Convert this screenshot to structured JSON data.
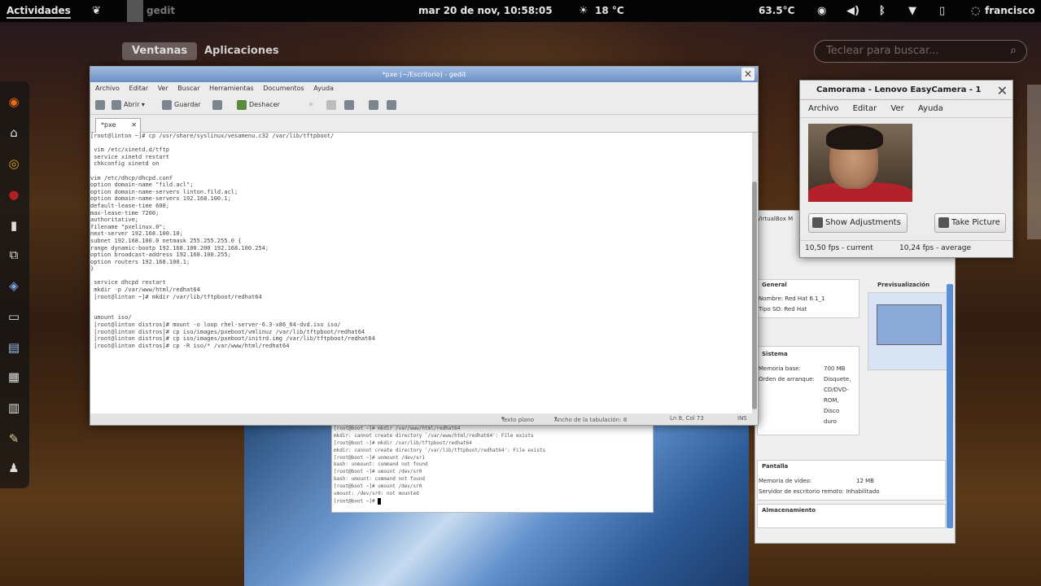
{
  "topbar": {
    "activities": "Actividades",
    "app_name": "gedit",
    "datetime": "mar 20 de nov, 10:58:05",
    "weather": "18 °C",
    "temperature": "63.5°C",
    "user": "francisco"
  },
  "overview": {
    "tabs": [
      "Ventanas",
      "Aplicaciones"
    ],
    "search_placeholder": "Teclear para buscar..."
  },
  "dash": {
    "icons": [
      "firefox-icon",
      "home-folder-icon",
      "chrome-icon",
      "red-app-icon",
      "phone-icon",
      "network-icon",
      "virtualbox-icon",
      "terminal-icon",
      "document-icon",
      "archive-icon",
      "text-icon",
      "notes-icon",
      "user-icon"
    ]
  },
  "gedit": {
    "title": "*pxe (~/Escritorio) - gedit",
    "menu": [
      "Archivo",
      "Editar",
      "Ver",
      "Buscar",
      "Herramientas",
      "Documentos",
      "Ayuda"
    ],
    "toolbar": {
      "open": "Abrir",
      "save": "Guardar",
      "undo": "Deshacer"
    },
    "tab_label": "*pxe",
    "lines": [
      "[root@linton ~]# cp /usr/share/syslinux/vesamenu.c32 /var/lib/tftpboot/",
      "",
      " vim /etc/xinetd.d/tftp",
      " service xinetd restart",
      " chkconfig xinetd on",
      "",
      "vim /etc/dhcp/dhcpd.conf",
      "option domain-name \"fild.acl\";",
      "option domain-name-servers linton.fild.acl;",
      "option domain-name-servers 192.168.100.1;",
      "default-lease-time 600;",
      "max-lease-time 7200;",
      "authoritative;",
      "filename \"pxelinux.0\";",
      "next-server 192.168.100.10;",
      "subnet 192.168.100.0 netmask 255.255.255.0 {",
      "range dynamic-bootp 192.168.100.200 192.168.100.254;",
      "option broadcast-address 192.168.100.255;",
      "option routers 192.168.100.1;",
      "}",
      "",
      " service dhcpd restart",
      " mkdir -p /var/www/html/redhat64",
      " [root@linton ~]# mkdir /var/lib/tftpboot/redhat64",
      "",
      "",
      " umount iso/",
      " [root@linton distros]# mount -o loop rhel-server-6.3-x86_64-dvd.iso iso/",
      " [root@linton distros]# cp iso/images/pxeboot/vmlinuz /var/lib/tftpboot/redhat64",
      " [root@linton distros]# cp iso/images/pxeboot/initrd.img /var/lib/tftpboot/redhat64",
      " [root@linton distros]# cp -R iso/* /var/www/html/redhat64"
    ],
    "status": {
      "syntax": "Texto plano",
      "tab_width": "Ancho de la tabulación: 8",
      "position": "Ln 8, Col 73",
      "mode": "INS"
    }
  },
  "terminal": {
    "lines": [
      "[root@boot ~]# mkdir /var/www/html/redhat64",
      "mkdir: cannot create directory `/var/www/html/redhat64': File exists",
      "[root@boot ~]# mkdir /var/lib/tftpboot/redhat64",
      "mkdir: cannot create directory `/var/lib/tftpboot/redhat64': File exists",
      "[root@boot ~]# unmount /dev/sr1",
      "bash: unmount: command not found",
      "[root@boot ~]# umount /dev/sr0",
      "bash: umount: command not found",
      "[root@boot ~]# umount /dev/sr0",
      "umount: /dev/sr0: not mounted",
      "[root@boot ~]# "
    ]
  },
  "vbox": {
    "tab": "VirtualBox M",
    "general_header": "General",
    "name": "Nombre: Red Hat 6.1_1",
    "os": "Tipo SO: Red Hat",
    "preview_header": "Previsualización",
    "system_header": "Sistema",
    "memory_label": "Memoria base:",
    "memory_value": "700 MB",
    "boot_label": "Orden de arranque:",
    "boot_value": [
      "Disquete,",
      "CD/DVD-",
      "ROM,",
      "Disco",
      "duro"
    ],
    "display_header": "Pantalla",
    "video_label": "Memoria de vídeo:",
    "video_value": "12 MB",
    "rdp": "Servidor de escritorio remoto: Inhabilitado",
    "storage_header": "Almacenamiento"
  },
  "cheese": {
    "title": "Camorama - Lenovo EasyCamera - 1",
    "menu": [
      "Archivo",
      "Editar",
      "Ver",
      "Ayuda"
    ],
    "show_adjustments": "Show Adjustments",
    "take_picture": "Take Picture",
    "fps_current": "10,50 fps - current",
    "fps_average": "10,24 fps - average"
  }
}
